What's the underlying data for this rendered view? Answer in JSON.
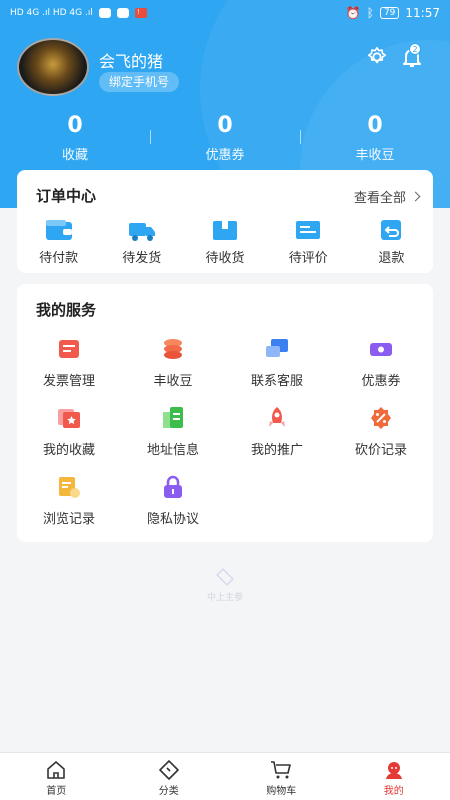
{
  "status_bar": {
    "left_text": "HD 4G .ıl HD 4G .ıl",
    "battery": "79",
    "time": "11:57"
  },
  "profile": {
    "username": "会飞的猪",
    "bind_phone_label": "绑定手机号",
    "notification_badge": "2"
  },
  "stats": [
    {
      "value": "0",
      "label": "收藏"
    },
    {
      "value": "0",
      "label": "优惠券"
    },
    {
      "value": "0",
      "label": "丰收豆"
    }
  ],
  "orders": {
    "title": "订单中心",
    "view_all": "查看全部",
    "items": [
      {
        "label": "待付款",
        "icon": "wallet-icon"
      },
      {
        "label": "待发货",
        "icon": "truck-icon"
      },
      {
        "label": "待收货",
        "icon": "package-icon"
      },
      {
        "label": "待评价",
        "icon": "review-icon"
      },
      {
        "label": "退款",
        "icon": "refund-icon"
      }
    ]
  },
  "services": {
    "title": "我的服务",
    "items": [
      {
        "label": "发票管理",
        "icon": "invoice-icon"
      },
      {
        "label": "丰收豆",
        "icon": "coins-icon"
      },
      {
        "label": "联系客服",
        "icon": "chat-icon"
      },
      {
        "label": "优惠券",
        "icon": "coupon-icon"
      },
      {
        "label": "我的收藏",
        "icon": "favorite-icon"
      },
      {
        "label": "地址信息",
        "icon": "address-icon"
      },
      {
        "label": "我的推广",
        "icon": "rocket-icon"
      },
      {
        "label": "砍价记录",
        "icon": "discount-icon"
      },
      {
        "label": "浏览记录",
        "icon": "history-icon"
      },
      {
        "label": "隐私协议",
        "icon": "lock-icon"
      }
    ]
  },
  "watermark_text": "中上主参",
  "tabbar": [
    {
      "label": "首页",
      "icon": "home-icon"
    },
    {
      "label": "分类",
      "icon": "category-icon"
    },
    {
      "label": "购物车",
      "icon": "cart-icon"
    },
    {
      "label": "我的",
      "icon": "profile-icon"
    }
  ],
  "colors": {
    "primary": "#2ea6f2",
    "active_tab": "#e53935",
    "background": "#f4f5f7"
  }
}
